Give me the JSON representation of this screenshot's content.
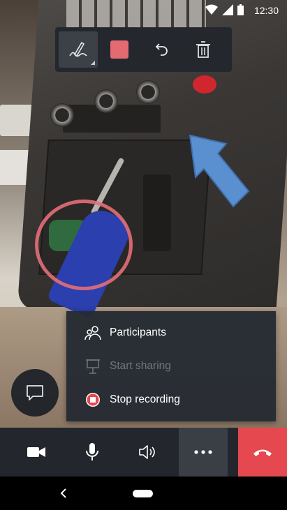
{
  "status_bar": {
    "time": "12:30"
  },
  "ink_toolbar": {
    "tools": [
      {
        "name": "pen",
        "icon": "pen-icon",
        "active": true
      },
      {
        "name": "color",
        "icon": "color-swatch",
        "color": "#e46a72"
      },
      {
        "name": "undo",
        "icon": "undo-icon"
      },
      {
        "name": "delete",
        "icon": "trash-icon"
      }
    ]
  },
  "menu": {
    "items": [
      {
        "label": "Participants",
        "icon": "people-icon",
        "enabled": true
      },
      {
        "label": "Start sharing",
        "icon": "presentation-icon",
        "enabled": false
      },
      {
        "label": "Stop recording",
        "icon": "stop-recording-icon",
        "enabled": true
      }
    ]
  },
  "call_controls": [
    {
      "name": "camera",
      "icon": "video-camera-icon"
    },
    {
      "name": "microphone",
      "icon": "microphone-icon"
    },
    {
      "name": "speaker",
      "icon": "speaker-icon"
    },
    {
      "name": "more",
      "icon": "more-icon"
    },
    {
      "name": "hang-up",
      "icon": "hang-up-icon"
    }
  ],
  "colors": {
    "ink": "#e46a72",
    "hangup": "#e5484e",
    "arrow": "#5a8fd0",
    "toolbar_bg": "#22262c"
  }
}
